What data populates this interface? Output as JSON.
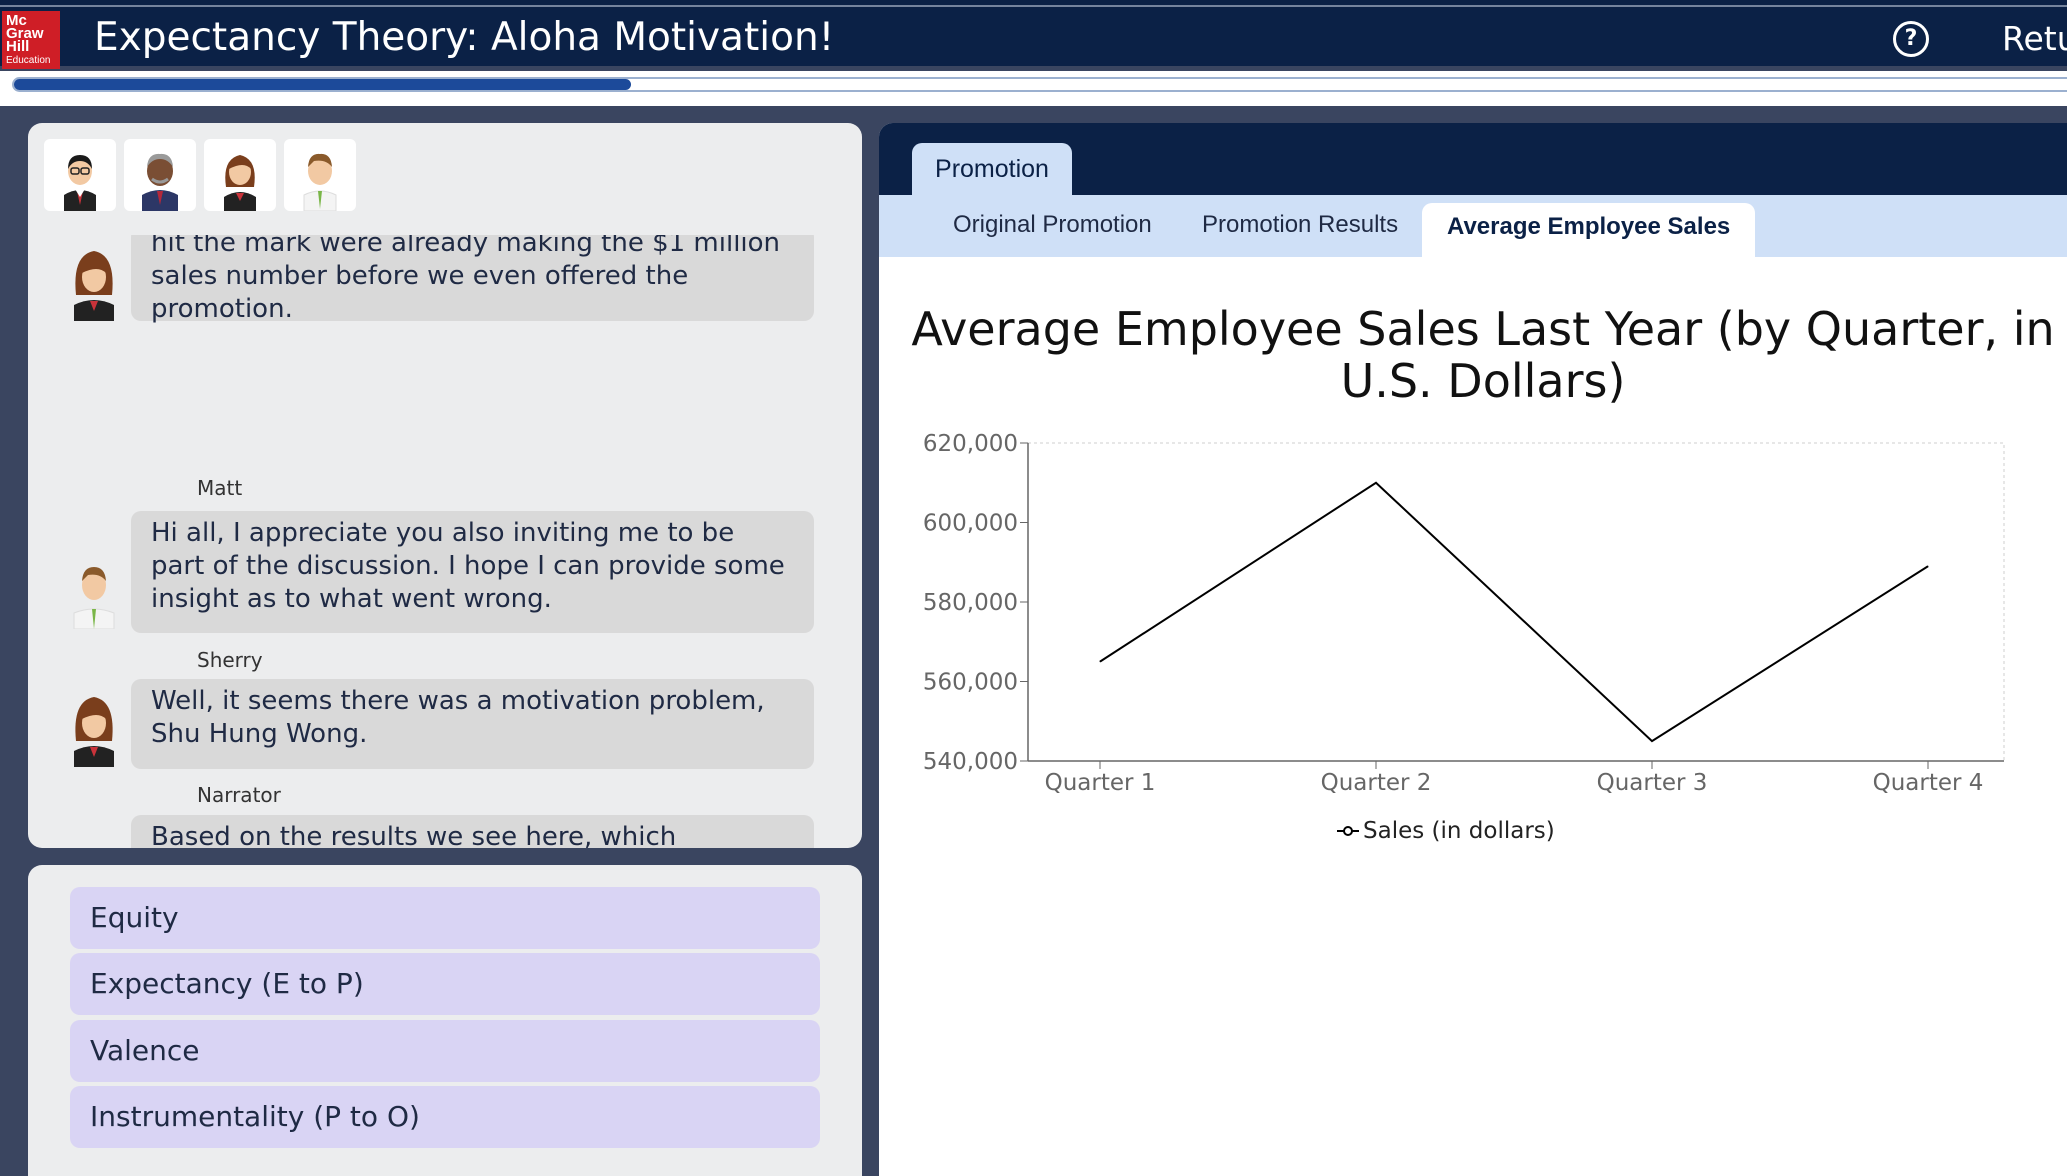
{
  "app": {
    "logo_lines": [
      "Mc",
      "Graw",
      "Hill"
    ],
    "logo_sub": "Education",
    "title": "Expectancy Theory: Aloha Motivation!",
    "help_icon": "question-circle-icon",
    "return_label": "Retu",
    "progress_fraction": 0.3
  },
  "chat": {
    "avatars": [
      "narrator-avatar",
      "elder-man-avatar",
      "sherry-avatar",
      "matt-avatar"
    ],
    "messages": [
      {
        "speaker": "",
        "face": "sherry",
        "text": "hit the mark were already making the $1 million sales number before we even offered the promotion."
      },
      {
        "speaker": "Matt",
        "face": "matt",
        "text": "Hi all, I appreciate you also inviting me to be part of the discussion. I hope I can provide some insight as to what went wrong."
      },
      {
        "speaker": "Sherry",
        "face": "sherry",
        "text": "Well, it seems there was a motivation problem, Shu Hung Wong."
      },
      {
        "speaker": "Narrator",
        "face": "narrator",
        "text": "Based on the results we see here, which component of the Expectancy Theory of Motivation may be the issue?"
      }
    ]
  },
  "answers": {
    "options": [
      "Equity",
      "Expectancy (E to P)",
      "Valence",
      "Instrumentality (P to O)"
    ]
  },
  "right": {
    "main_tab": "Promotion",
    "subtabs": [
      "Original Promotion",
      "Promotion Results",
      "Average Employee Sales"
    ],
    "active_subtab": "Average Employee Sales"
  },
  "chart_data": {
    "type": "line",
    "title_line1": "Average Employee Sales Last Year (by Quarter, in",
    "title_line2": "U.S. Dollars)",
    "categories": [
      "Quarter 1",
      "Quarter 2",
      "Quarter 3",
      "Quarter 4"
    ],
    "series": [
      {
        "name": "Sales (in dollars)",
        "values": [
          565000,
          610000,
          545000,
          589000
        ],
        "color": "#000000"
      }
    ],
    "ylim": [
      540000,
      620000
    ],
    "yticks": [
      "540,000",
      "560,000",
      "580,000",
      "600,000",
      "620,000"
    ],
    "ytick_values": [
      540000,
      560000,
      580000,
      600000,
      620000
    ],
    "grid": false,
    "legend_position": "bottom-center"
  }
}
